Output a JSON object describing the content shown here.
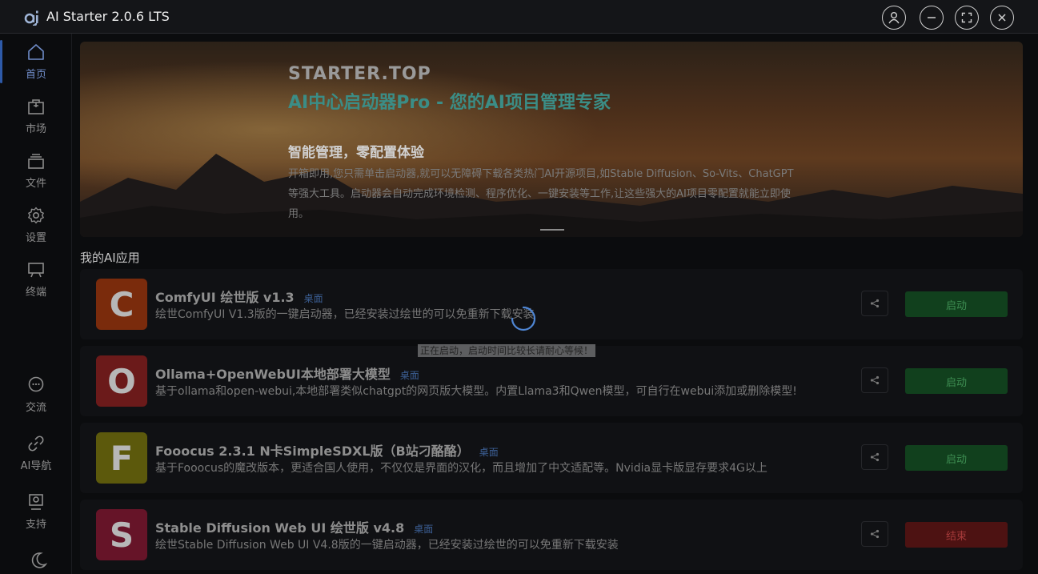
{
  "window": {
    "title": "AI Starter 2.0.6 LTS"
  },
  "sidebar": {
    "items": [
      {
        "label": "首页",
        "icon": "home-icon"
      },
      {
        "label": "市场",
        "icon": "market-icon"
      },
      {
        "label": "文件",
        "icon": "files-icon"
      },
      {
        "label": "设置",
        "icon": "gear-icon"
      },
      {
        "label": "终端",
        "icon": "terminal-icon"
      },
      {
        "label": "交流",
        "icon": "chat-icon"
      },
      {
        "label": "AI导航",
        "icon": "link-icon"
      },
      {
        "label": "支持",
        "icon": "support-icon"
      }
    ],
    "theme_icon": "moon-icon"
  },
  "banner": {
    "brand": "STARTER.TOP",
    "slogan": "AI中心启动器Pro - 您的AI项目管理专家",
    "heading": "智能管理，零配置体验",
    "description": "开箱即用,您只需单击启动器,就可以无障碍下载各类热门AI开源项目,如Stable Diffusion、So-Vits、ChatGPT等强大工具。启动器会自动完成环境检测、程序优化、一键安装等工作,让这些强大的AI项目零配置就能立即使用。"
  },
  "apps_section": {
    "title": "我的AI应用"
  },
  "apps": [
    {
      "letter": "C",
      "color": "#7a2b0c",
      "title": "ComfyUI 绘世版 v1.3",
      "tag": "桌面",
      "description": "绘世ComfyUI V1.3版的一键启动器，已经安装过绘世的可以免重新下载安装",
      "action": "启动"
    },
    {
      "letter": "O",
      "color": "#6b1a1a",
      "title": "Ollama+OpenWebUI本地部署大模型",
      "tag": "桌面",
      "description": "基于ollama和open-webui,本地部署类似chatgpt的网页版大模型。内置Llama3和Qwen模型，可自行在webui添加或删除模型!",
      "action": "启动"
    },
    {
      "letter": "F",
      "color": "#5c590c",
      "title": "Fooocus 2.3.1 N卡SimpleSDXL版（B站刁酪酪）",
      "tag": "桌面",
      "description": "基于Fooocus的魔改版本，更适合国人使用，不仅仅是界面的汉化，而且增加了中文适配等。Nvidia显卡版显存要求4G以上",
      "action": "启动"
    },
    {
      "letter": "S",
      "color": "#661428",
      "title": "Stable Diffusion Web UI 绘世版 v4.8",
      "tag": "桌面",
      "description": "绘世Stable Diffusion Web UI V4.8版的一键启动器，已经安装过绘世的可以免重新下载安装",
      "action": "结束"
    }
  ],
  "loading": {
    "message": "正在启动，启动时间比较长请耐心等候！"
  }
}
